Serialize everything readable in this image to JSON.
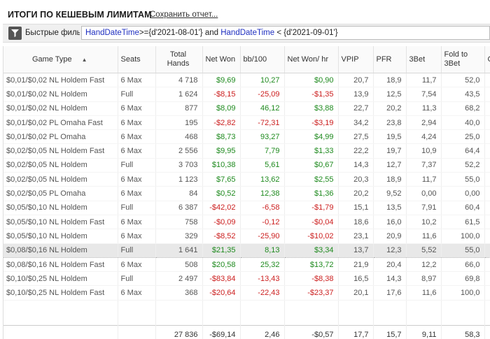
{
  "header": {
    "title": "ИТОГИ ПО КЕШЕВЫМ ЛИМИТАМ",
    "save_link": "Сохранить отчет..."
  },
  "filter": {
    "label": "Быстрые фильт",
    "kw1": "HandDateTime",
    "op1": ">={d'2021-08-01'} and ",
    "kw2": "HandDateTime",
    "op2": " < {d'2021-09-01'}"
  },
  "table": {
    "columns": [
      {
        "key": "game",
        "label": "Game Type",
        "align": "left"
      },
      {
        "key": "seats",
        "label": "Seats",
        "align": "left"
      },
      {
        "key": "hands",
        "label": "Total Hands"
      },
      {
        "key": "net",
        "label": "Net Won",
        "align": "left"
      },
      {
        "key": "bb",
        "label": "bb/100",
        "align": "left"
      },
      {
        "key": "nethr",
        "label": "Net Won/ hr",
        "align": "left"
      },
      {
        "key": "vpip",
        "label": "VPIP",
        "align": "left"
      },
      {
        "key": "pfr",
        "label": "PFR",
        "align": "left"
      },
      {
        "key": "threebet",
        "label": "3Bet",
        "align": "left"
      },
      {
        "key": "fold3b",
        "label": "Fold to 3Bet",
        "align": "left"
      },
      {
        "key": "cb",
        "label": "CB",
        "align": "left"
      }
    ],
    "sort_indicator": "▲",
    "rows": [
      {
        "game": "$0,01/$0,02 NL Holdem Fast",
        "seats": "6 Max",
        "hands": "4 718",
        "net": "$9,69",
        "bb": "10,27",
        "nethr": "$0,90",
        "vpip": "20,7",
        "pfr": "18,9",
        "threebet": "11,7",
        "fold3b": "52,0",
        "cb": ""
      },
      {
        "game": "$0,01/$0,02 NL Holdem",
        "seats": "Full",
        "hands": "1 624",
        "net": "-$8,15",
        "bb": "-25,09",
        "nethr": "-$1,35",
        "vpip": "13,9",
        "pfr": "12,5",
        "threebet": "7,54",
        "fold3b": "43,5",
        "cb": ""
      },
      {
        "game": "$0,01/$0,02 NL Holdem",
        "seats": "6 Max",
        "hands": "877",
        "net": "$8,09",
        "bb": "46,12",
        "nethr": "$3,88",
        "vpip": "22,7",
        "pfr": "20,2",
        "threebet": "11,3",
        "fold3b": "68,2",
        "cb": ""
      },
      {
        "game": "$0,01/$0,02 PL Omaha Fast",
        "seats": "6 Max",
        "hands": "195",
        "net": "-$2,82",
        "bb": "-72,31",
        "nethr": "-$3,19",
        "vpip": "34,2",
        "pfr": "23,8",
        "threebet": "2,94",
        "fold3b": "40,0",
        "cb": ""
      },
      {
        "game": "$0,01/$0,02 PL Omaha",
        "seats": "6 Max",
        "hands": "468",
        "net": "$8,73",
        "bb": "93,27",
        "nethr": "$4,99",
        "vpip": "27,5",
        "pfr": "19,5",
        "threebet": "4,24",
        "fold3b": "25,0",
        "cb": ""
      },
      {
        "game": "$0,02/$0,05 NL Holdem Fast",
        "seats": "6 Max",
        "hands": "2 556",
        "net": "$9,95",
        "bb": "7,79",
        "nethr": "$1,33",
        "vpip": "22,2",
        "pfr": "19,7",
        "threebet": "10,9",
        "fold3b": "64,4",
        "cb": ""
      },
      {
        "game": "$0,02/$0,05 NL Holdem",
        "seats": "Full",
        "hands": "3 703",
        "net": "$10,38",
        "bb": "5,61",
        "nethr": "$0,67",
        "vpip": "14,3",
        "pfr": "12,7",
        "threebet": "7,37",
        "fold3b": "52,2",
        "cb": ""
      },
      {
        "game": "$0,02/$0,05 NL Holdem",
        "seats": "6 Max",
        "hands": "1 123",
        "net": "$7,65",
        "bb": "13,62",
        "nethr": "$2,55",
        "vpip": "20,3",
        "pfr": "18,9",
        "threebet": "11,7",
        "fold3b": "55,0",
        "cb": ""
      },
      {
        "game": "$0,02/$0,05 PL Omaha",
        "seats": "6 Max",
        "hands": "84",
        "net": "$0,52",
        "bb": "12,38",
        "nethr": "$1,36",
        "vpip": "20,2",
        "pfr": "9,52",
        "threebet": "0,00",
        "fold3b": "0,00",
        "cb": ""
      },
      {
        "game": "$0,05/$0,10 NL Holdem",
        "seats": "Full",
        "hands": "6 387",
        "net": "-$42,02",
        "bb": "-6,58",
        "nethr": "-$1,79",
        "vpip": "15,1",
        "pfr": "13,5",
        "threebet": "7,91",
        "fold3b": "60,4",
        "cb": ""
      },
      {
        "game": "$0,05/$0,10 NL Holdem Fast",
        "seats": "6 Max",
        "hands": "758",
        "net": "-$0,09",
        "bb": "-0,12",
        "nethr": "-$0,04",
        "vpip": "18,6",
        "pfr": "16,0",
        "threebet": "10,2",
        "fold3b": "61,5",
        "cb": ""
      },
      {
        "game": "$0,05/$0,10 NL Holdem",
        "seats": "6 Max",
        "hands": "329",
        "net": "-$8,52",
        "bb": "-25,90",
        "nethr": "-$10,02",
        "vpip": "23,1",
        "pfr": "20,9",
        "threebet": "11,6",
        "fold3b": "100,0",
        "cb": ""
      },
      {
        "game": "$0,08/$0,16 NL Holdem",
        "seats": "Full",
        "hands": "1 641",
        "net": "$21,35",
        "bb": "8,13",
        "nethr": "$3,34",
        "vpip": "13,7",
        "pfr": "12,3",
        "threebet": "5,52",
        "fold3b": "55,0",
        "cb": ""
      },
      {
        "game": "$0,08/$0,16 NL Holdem Fast",
        "seats": "6 Max",
        "hands": "508",
        "net": "$20,58",
        "bb": "25,32",
        "nethr": "$13,72",
        "vpip": "21,9",
        "pfr": "20,4",
        "threebet": "12,2",
        "fold3b": "66,0",
        "cb": ""
      },
      {
        "game": "$0,10/$0,25 NL Holdem",
        "seats": "Full",
        "hands": "2 497",
        "net": "-$83,84",
        "bb": "-13,43",
        "nethr": "-$8,38",
        "vpip": "16,5",
        "pfr": "14,3",
        "threebet": "8,97",
        "fold3b": "69,8",
        "cb": ""
      },
      {
        "game": "$0,10/$0,25 NL Holdem Fast",
        "seats": "6 Max",
        "hands": "368",
        "net": "-$20,64",
        "bb": "-22,43",
        "nethr": "-$23,37",
        "vpip": "20,1",
        "pfr": "17,6",
        "threebet": "11,6",
        "fold3b": "100,0",
        "cb": ""
      }
    ],
    "selected_row_index": 12,
    "totals": {
      "game": "",
      "seats": "",
      "hands": "27 836",
      "net": "-$69,14",
      "bb": "2,46",
      "nethr": "-$0,57",
      "vpip": "17,7",
      "pfr": "15,7",
      "threebet": "9,11",
      "fold3b": "58,3",
      "cb": ""
    }
  },
  "colors": {
    "positive": "#1e8a1e",
    "negative": "#cc2020",
    "accent": "#2030c0"
  },
  "icons": {
    "filter": "filter-funnel-icon"
  }
}
